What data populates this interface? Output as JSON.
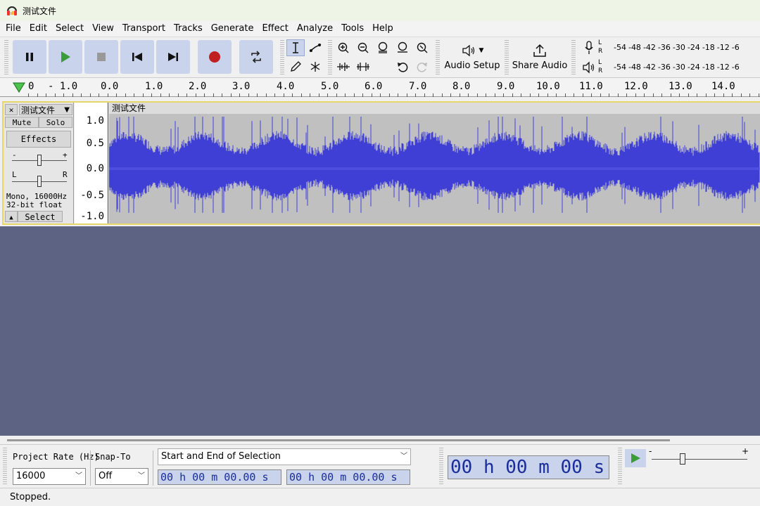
{
  "window": {
    "title": "测试文件"
  },
  "menu": [
    "File",
    "Edit",
    "Select",
    "View",
    "Transport",
    "Tracks",
    "Generate",
    "Effect",
    "Analyze",
    "Tools",
    "Help"
  ],
  "toolbar": {
    "audio_setup_label": "Audio Setup",
    "share_audio_label": "Share Audio",
    "meter_ticks": [
      "-54",
      "-48",
      "-42",
      "-36",
      "-30",
      "-24",
      "-18",
      "-12",
      "-6"
    ],
    "rec_channels": [
      "L",
      "R"
    ],
    "play_channels": [
      "L",
      "R"
    ]
  },
  "ruler": {
    "ticks": [
      "0",
      "- 1.0",
      "0.0",
      "1.0",
      "2.0",
      "3.0",
      "4.0",
      "5.0",
      "6.0",
      "7.0",
      "8.0",
      "9.0",
      "10.0",
      "11.0",
      "12.0",
      "13.0",
      "14.0"
    ]
  },
  "track": {
    "name": "测试文件",
    "clip_name": "测试文件",
    "mute_label": "Mute",
    "solo_label": "Solo",
    "effects_label": "Effects",
    "gain_minus": "-",
    "gain_plus": "+",
    "pan_left": "L",
    "pan_right": "R",
    "info_line1": "Mono, 16000Hz",
    "info_line2": "32-bit float",
    "select_label": "Select",
    "amp_labels": [
      "1.0",
      "0.5",
      "0.0",
      "-0.5",
      "-1.0"
    ],
    "wave_color": "#3f3fd6"
  },
  "selection": {
    "project_rate_label": "Project Rate (Hz)",
    "project_rate_value": "16000",
    "snap_to_label": "Snap-To",
    "snap_to_value": "Off",
    "selection_mode": "Start and End of Selection",
    "start_time": "00 h 00 m 00.00 s",
    "end_time": "00 h 00 m 00.00 s",
    "big_time": "00 h 00 m 00 s",
    "speed_minus": "-",
    "speed_plus": "+"
  },
  "status": {
    "text": "Stopped."
  }
}
